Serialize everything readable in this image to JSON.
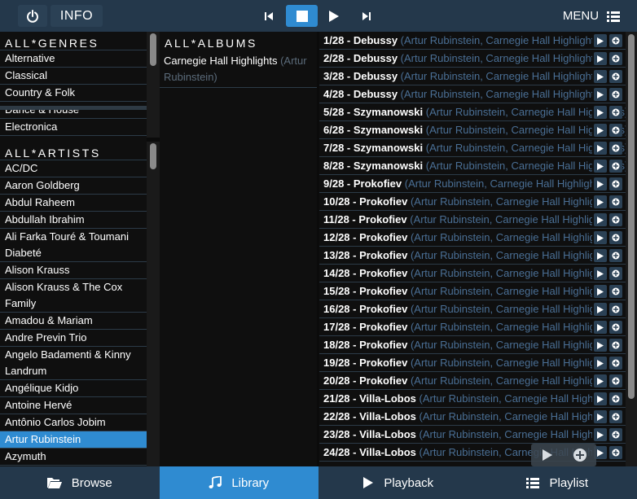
{
  "topbar": {
    "info_label": "INFO",
    "menu_label": "MENU"
  },
  "genres": {
    "title": "ALL*GENRES",
    "items": [
      "Alternative",
      "Classical",
      "Country & Folk",
      "Dance & House",
      "Electronica"
    ]
  },
  "artists": {
    "title": "ALL*ARTISTS",
    "items": [
      "AC/DC",
      "Aaron Goldberg",
      "Abdul Raheem",
      "Abdullah Ibrahim",
      "Ali Farka Touré & Toumani Diabeté",
      "Alison Krauss",
      "Alison Krauss & The Cox Family",
      "Amadou & Mariam",
      "Andre Previn Trio",
      "Angelo Badamenti & Kinny Landrum",
      "Angélique Kidjo",
      "Antoine Hervé",
      "Antônio Carlos Jobim",
      "Artur Rubinstein",
      "Azymuth"
    ],
    "selected": "Artur Rubinstein"
  },
  "albums": {
    "title": "ALL*ALBUMS",
    "items": [
      {
        "title": "Carnegie Hall Highlights",
        "artist": "(Artur Rubinstein)"
      }
    ]
  },
  "tracks": [
    {
      "num": "1/28 - Debussy",
      "meta": "(Artur Rubinstein, Carnegie Hall Highlights)"
    },
    {
      "num": "2/28 - Debussy",
      "meta": "(Artur Rubinstein, Carnegie Hall Highlights)"
    },
    {
      "num": "3/28 - Debussy",
      "meta": "(Artur Rubinstein, Carnegie Hall Highlights)"
    },
    {
      "num": "4/28 - Debussy",
      "meta": "(Artur Rubinstein, Carnegie Hall Highlights)"
    },
    {
      "num": "5/28 - Szymanowski",
      "meta": "(Artur Rubinstein, Carnegie Hall Highlights)"
    },
    {
      "num": "6/28 - Szymanowski",
      "meta": "(Artur Rubinstein, Carnegie Hall Highlights)"
    },
    {
      "num": "7/28 - Szymanowski",
      "meta": "(Artur Rubinstein, Carnegie Hall Highlights)"
    },
    {
      "num": "8/28 - Szymanowski",
      "meta": "(Artur Rubinstein, Carnegie Hall Highlights)"
    },
    {
      "num": "9/28 - Prokofiev",
      "meta": "(Artur Rubinstein, Carnegie Hall Highlights)"
    },
    {
      "num": "10/28 - Prokofiev",
      "meta": "(Artur Rubinstein, Carnegie Hall Highlights)"
    },
    {
      "num": "11/28 - Prokofiev",
      "meta": "(Artur Rubinstein, Carnegie Hall Highlights)"
    },
    {
      "num": "12/28 - Prokofiev",
      "meta": "(Artur Rubinstein, Carnegie Hall Highlights)"
    },
    {
      "num": "13/28 - Prokofiev",
      "meta": "(Artur Rubinstein, Carnegie Hall Highlights)"
    },
    {
      "num": "14/28 - Prokofiev",
      "meta": "(Artur Rubinstein, Carnegie Hall Highlights)"
    },
    {
      "num": "15/28 - Prokofiev",
      "meta": "(Artur Rubinstein, Carnegie Hall Highlights)"
    },
    {
      "num": "16/28 - Prokofiev",
      "meta": "(Artur Rubinstein, Carnegie Hall Highlights)"
    },
    {
      "num": "17/28 - Prokofiev",
      "meta": "(Artur Rubinstein, Carnegie Hall Highlights)"
    },
    {
      "num": "18/28 - Prokofiev",
      "meta": "(Artur Rubinstein, Carnegie Hall Highlights)"
    },
    {
      "num": "19/28 - Prokofiev",
      "meta": "(Artur Rubinstein, Carnegie Hall Highlights)"
    },
    {
      "num": "20/28 - Prokofiev",
      "meta": "(Artur Rubinstein, Carnegie Hall Highlights)"
    },
    {
      "num": "21/28 - Villa-Lobos",
      "meta": "(Artur Rubinstein, Carnegie Hall Highlights)"
    },
    {
      "num": "22/28 - Villa-Lobos",
      "meta": "(Artur Rubinstein, Carnegie Hall Highlights)"
    },
    {
      "num": "23/28 - Villa-Lobos",
      "meta": "(Artur Rubinstein, Carnegie Hall Highlights)"
    },
    {
      "num": "24/28 - Villa-Lobos",
      "meta": "(Artur Rubinstein, Carnegie Hall Highlights)"
    }
  ],
  "bottomnav": [
    {
      "label": "Browse",
      "icon": "folder-open-icon"
    },
    {
      "label": "Library",
      "icon": "music-note-icon"
    },
    {
      "label": "Playback",
      "icon": "play-icon"
    },
    {
      "label": "Playlist",
      "icon": "list-icon"
    }
  ],
  "bottomnav_active": "Library",
  "colors": {
    "accent": "#2f8bd1",
    "bar": "#24384b",
    "meta_text": "#4a6f95"
  }
}
